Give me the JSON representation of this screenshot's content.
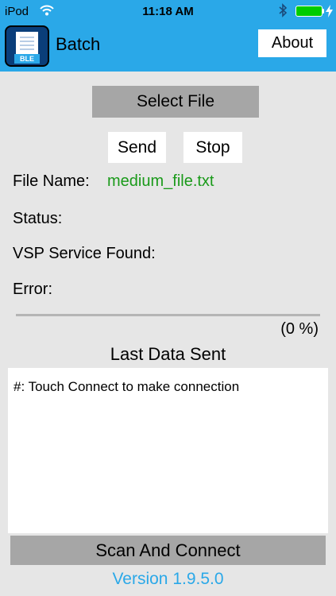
{
  "status_bar": {
    "carrier": "iPod",
    "time": "11:18 AM",
    "wifi_icon": "wifi-icon",
    "bluetooth_icon": "bluetooth-icon",
    "battery_icon": "battery-icon",
    "battery_color": "#00cc00"
  },
  "header": {
    "background": "#2aa8e8",
    "app_icon_label": "BLE",
    "title": "Batch",
    "about_label": "About"
  },
  "buttons": {
    "select_file": "Select File",
    "send": "Send",
    "stop": "Stop",
    "scan_connect": "Scan And Connect"
  },
  "file_info": {
    "file_name_label": "File Name:",
    "file_name_value": "medium_file.txt",
    "status_label": "Status:",
    "vsp_label": "VSP Service Found:",
    "error_label": "Error:"
  },
  "progress": {
    "percent_text": "(0 %)",
    "fraction": 0
  },
  "last_data": {
    "title": "Last Data Sent",
    "text": "#: Touch Connect to make connection"
  },
  "footer": {
    "version": "Version 1.9.5.0"
  }
}
